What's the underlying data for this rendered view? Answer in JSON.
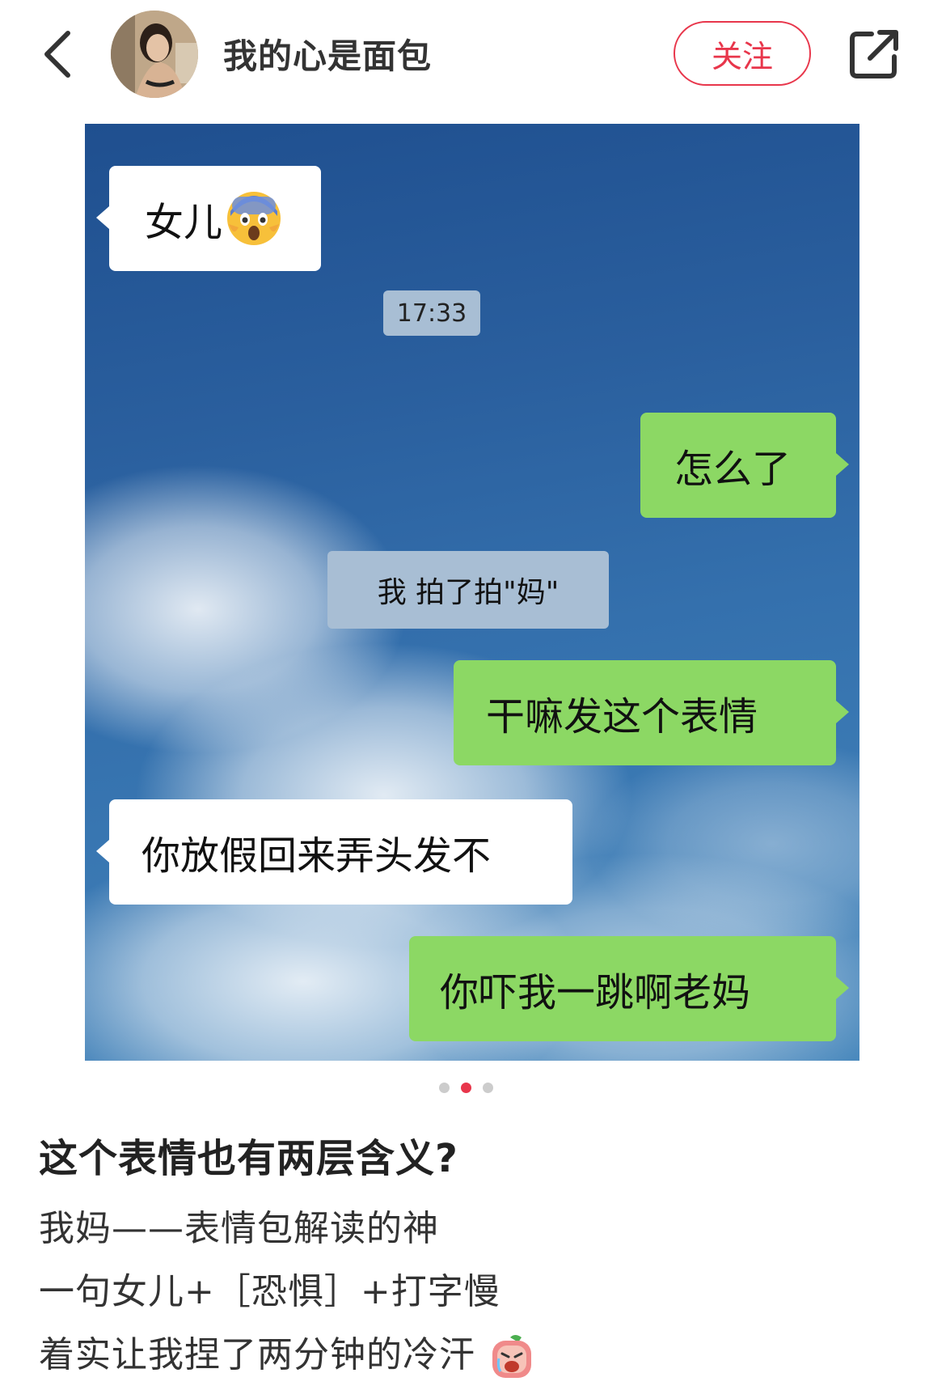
{
  "header": {
    "username": "我的心是面包",
    "follow_label": "关注"
  },
  "chat": {
    "messages": [
      {
        "side": "left",
        "text": "女儿",
        "emoji": "fearful-face"
      },
      {
        "side": "system",
        "text": "17:33"
      },
      {
        "side": "right",
        "text": "怎么了"
      },
      {
        "side": "system",
        "text": "我 拍了拍\"妈\""
      },
      {
        "side": "right",
        "text": "干嘛发这个表情"
      },
      {
        "side": "left",
        "text": "你放假回来弄头发不"
      },
      {
        "side": "right",
        "text": "你吓我一跳啊老妈"
      }
    ]
  },
  "pager": {
    "count": 3,
    "active": 2
  },
  "post": {
    "title": "这个表情也有两层含义?",
    "lines": [
      "我妈——表情包解读的神",
      "一句女儿+［恐惧］+打字慢",
      "着实让我捏了两分钟的冷汗"
    ],
    "trailing_emoji": "crying-face-sticker"
  },
  "colors": {
    "accent": "#e8364b",
    "bubble_green": "#8cd864",
    "bubble_white": "#ffffff",
    "system_grey": "#a8bed4"
  }
}
